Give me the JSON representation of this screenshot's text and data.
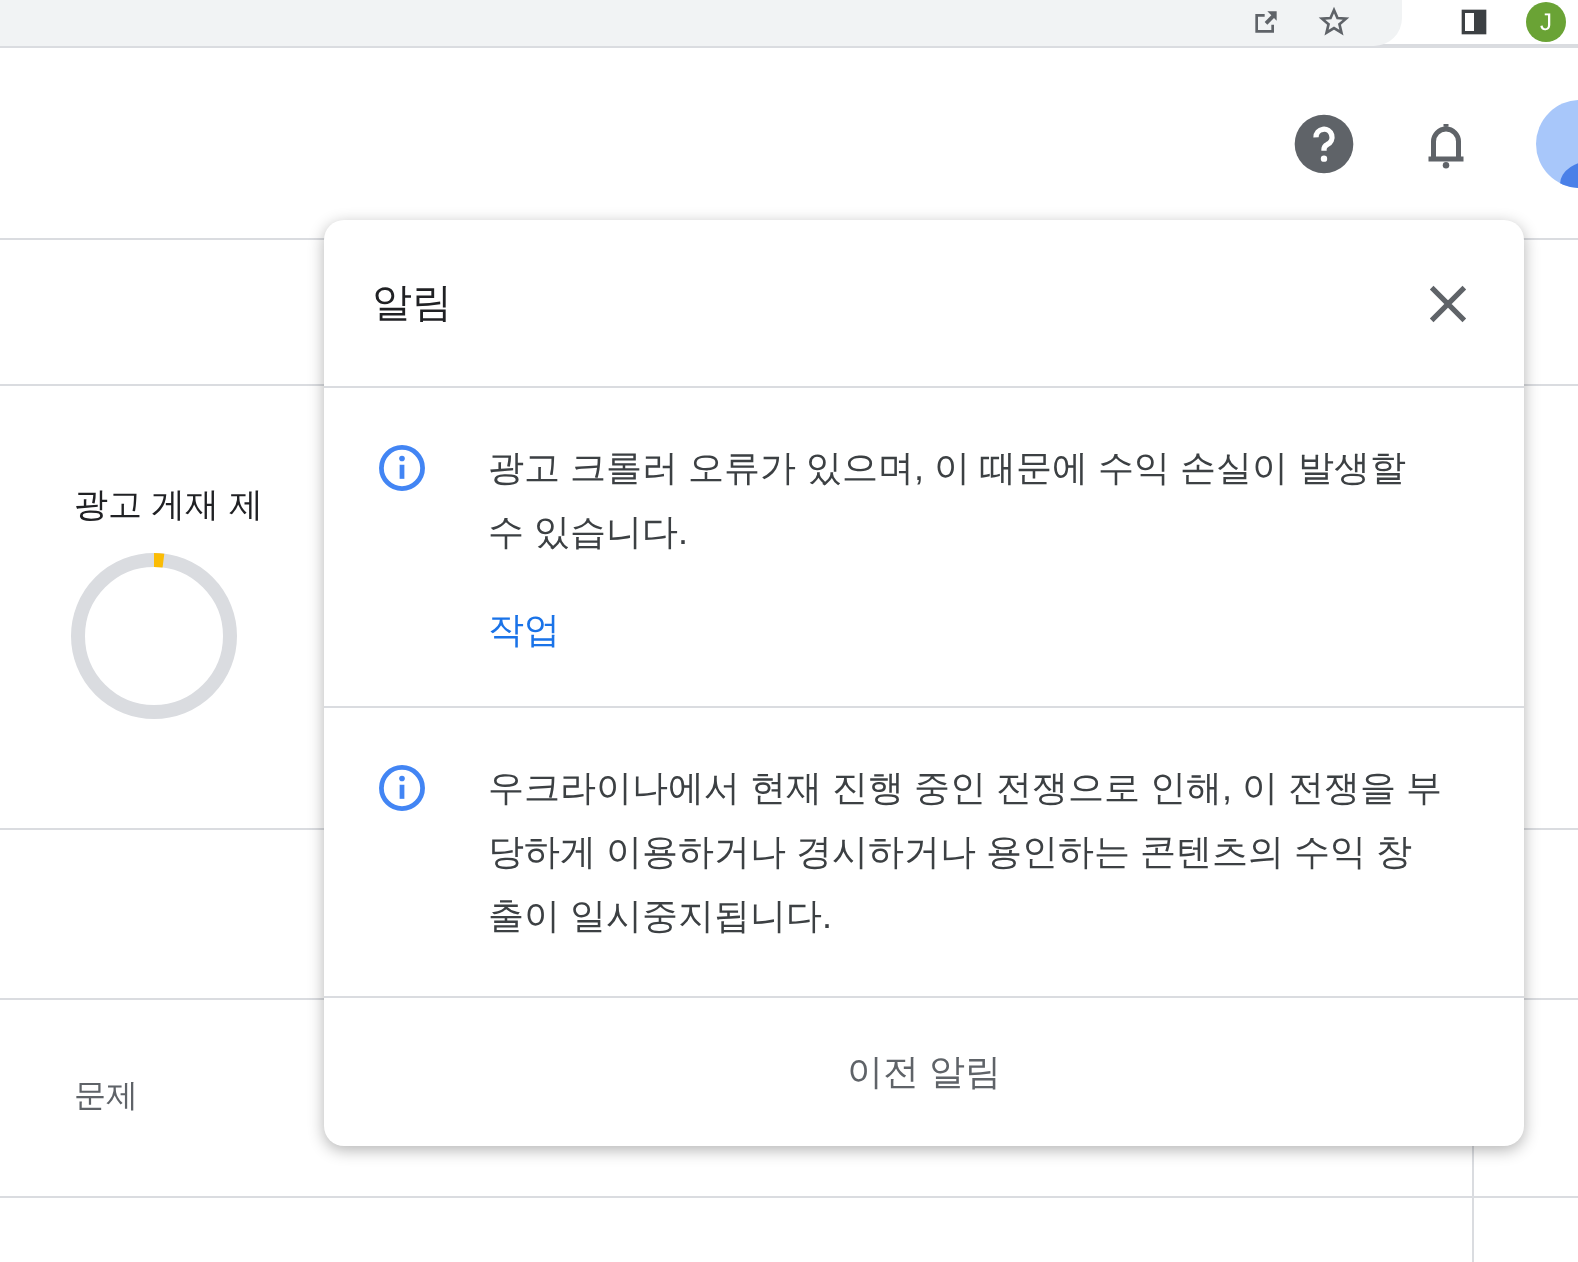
{
  "browser": {
    "profile_letter": "J"
  },
  "panel": {
    "title": "광고 게재 제",
    "ring": {
      "level": 0.02
    }
  },
  "table": {
    "column_1": "문제"
  },
  "notifications": {
    "title": "알림",
    "items": [
      {
        "text": "광고 크롤러 오류가 있으며, 이 때문에 수익 손실이 발생할 수 있습니다.",
        "action": "작업"
      },
      {
        "text": "우크라이나에서 현재 진행 중인 전쟁으로 인해, 이 전쟁을 부당하게 이용하거나 경시하거나 용인하는 콘텐츠의 수익 창출이 일시중지됩니다."
      }
    ],
    "footer": "이전 알림"
  }
}
